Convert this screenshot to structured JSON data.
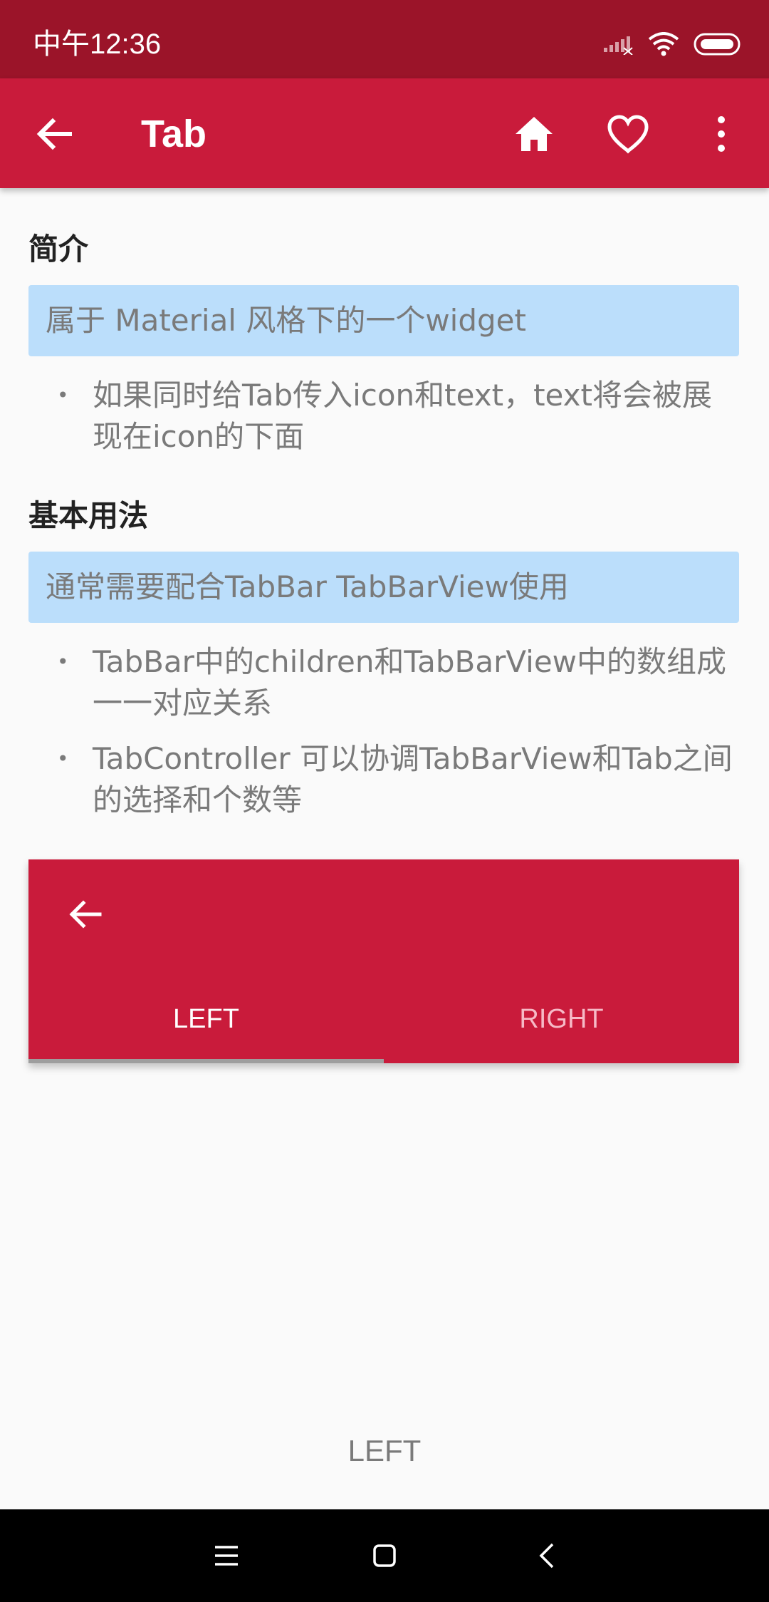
{
  "status_bar": {
    "time": "中午12:36"
  },
  "app_bar": {
    "title": "Tab",
    "icons": [
      "back-arrow-icon",
      "home-icon",
      "heart-icon",
      "more-vert-icon"
    ],
    "background": "#c91b3b"
  },
  "intro": {
    "title": "简介",
    "callout": "属于 Material 风格下的一个widget",
    "bullets": [
      "如果同时给Tab传入icon和text，text将会被展现在icon的下面"
    ]
  },
  "usage": {
    "title": "基本用法",
    "callout": "通常需要配合TabBar TabBarView使用",
    "bullets": [
      "TabBar中的children和TabBarView中的数组成一一对应关系",
      "TabController 可以协调TabBarView和Tab之间的选择和个数等"
    ]
  },
  "demo": {
    "tabs": [
      "LEFT",
      "RIGHT"
    ],
    "selected_tab": "LEFT",
    "view_text": "LEFT"
  },
  "colors": {
    "status_bar": "#9b1429",
    "primary": "#c91b3b",
    "callout_bg": "#bbdefb"
  }
}
